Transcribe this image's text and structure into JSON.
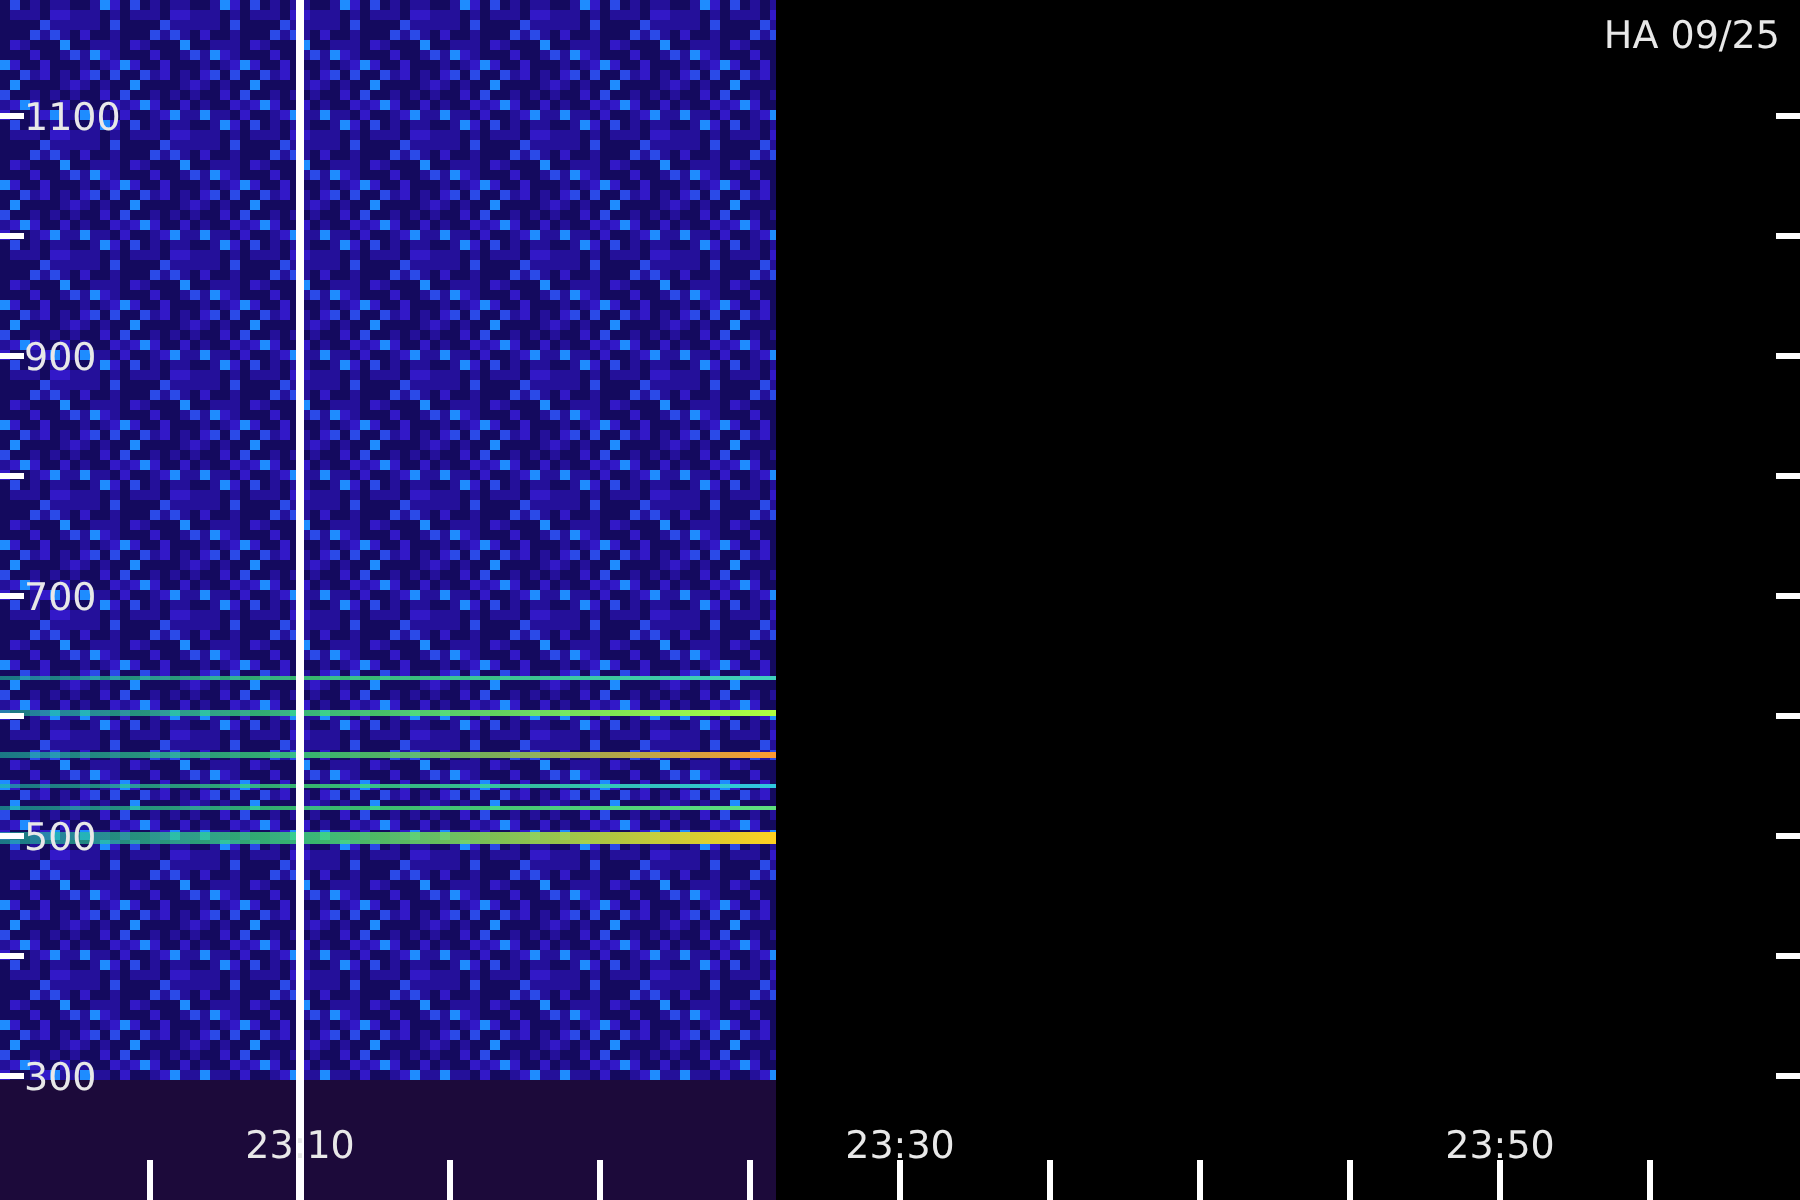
{
  "title": "HA 09/25",
  "y_axis": {
    "labels": [
      "1100",
      "900",
      "700",
      "500",
      "300"
    ]
  },
  "x_axis": {
    "labels": [
      "23:10",
      "23:30",
      "23:50"
    ]
  }
}
